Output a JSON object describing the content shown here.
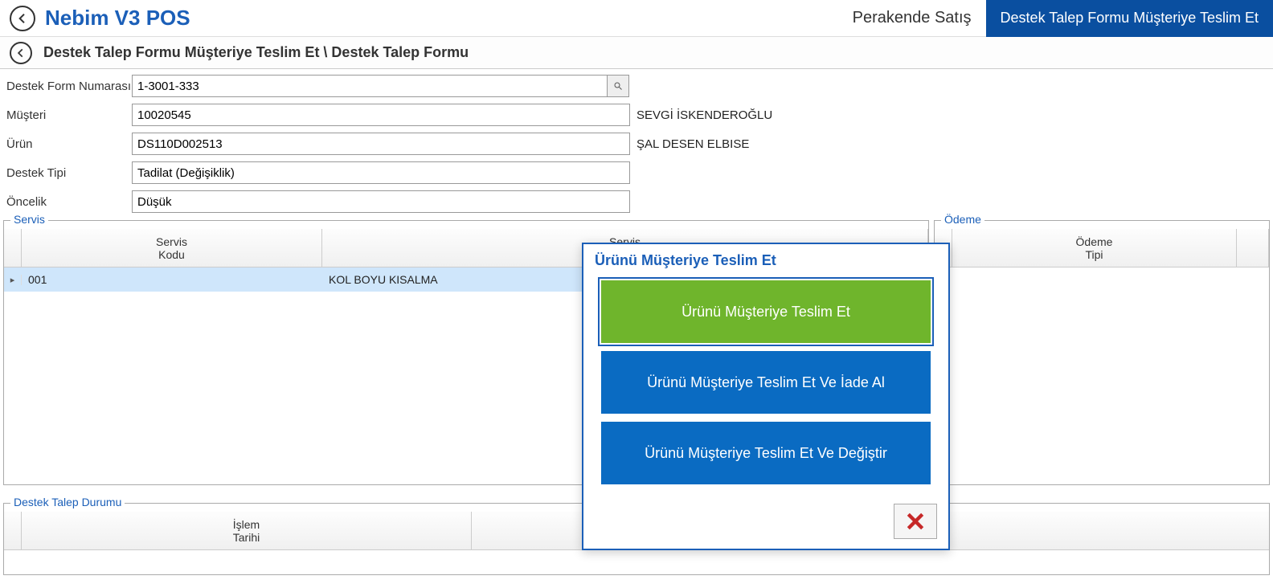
{
  "header": {
    "app_title": "Nebim V3 POS",
    "right_label": "Perakende Satış",
    "right_active": "Destek Talep Formu Müşteriye Teslim Et"
  },
  "breadcrumb": {
    "text": "Destek Talep Formu Müşteriye Teslim Et \\ Destek Talep Formu"
  },
  "form": {
    "labels": {
      "form_no": "Destek Form Numarası",
      "customer": "Müşteri",
      "product": "Ürün",
      "support_type": "Destek Tipi",
      "priority": "Öncelik"
    },
    "values": {
      "form_no": "1-3001-333",
      "customer": "10020545",
      "product": "DS110D002513",
      "support_type": "Tadilat (Değişiklik)",
      "priority": "Düşük"
    },
    "readouts": {
      "customer_name": "SEVGİ İSKENDEROĞLU",
      "product_name": "ŞAL DESEN ELBISE"
    }
  },
  "panels": {
    "servis": {
      "legend": "Servis",
      "headers": {
        "code": "Servis\nKodu",
        "name": "Servis\nAdı"
      },
      "rows": [
        {
          "code": "001",
          "name": "KOL BOYU KISALMA"
        }
      ]
    },
    "odeme": {
      "legend": "Ödeme",
      "headers": {
        "type": "Ödeme\nTipi"
      }
    },
    "status": {
      "legend": "Destek Talep Durumu",
      "headers": {
        "date": "İşlem\nTarihi"
      }
    }
  },
  "splitter": ".....",
  "dialog": {
    "title": "Ürünü Müşteriye Teslim Et",
    "buttons": {
      "deliver": "Ürünü Müşteriye Teslim Et",
      "deliver_return": "Ürünü Müşteriye Teslim Et Ve İade Al",
      "deliver_exchange": "Ürünü Müşteriye Teslim Et Ve Değiştir"
    }
  }
}
